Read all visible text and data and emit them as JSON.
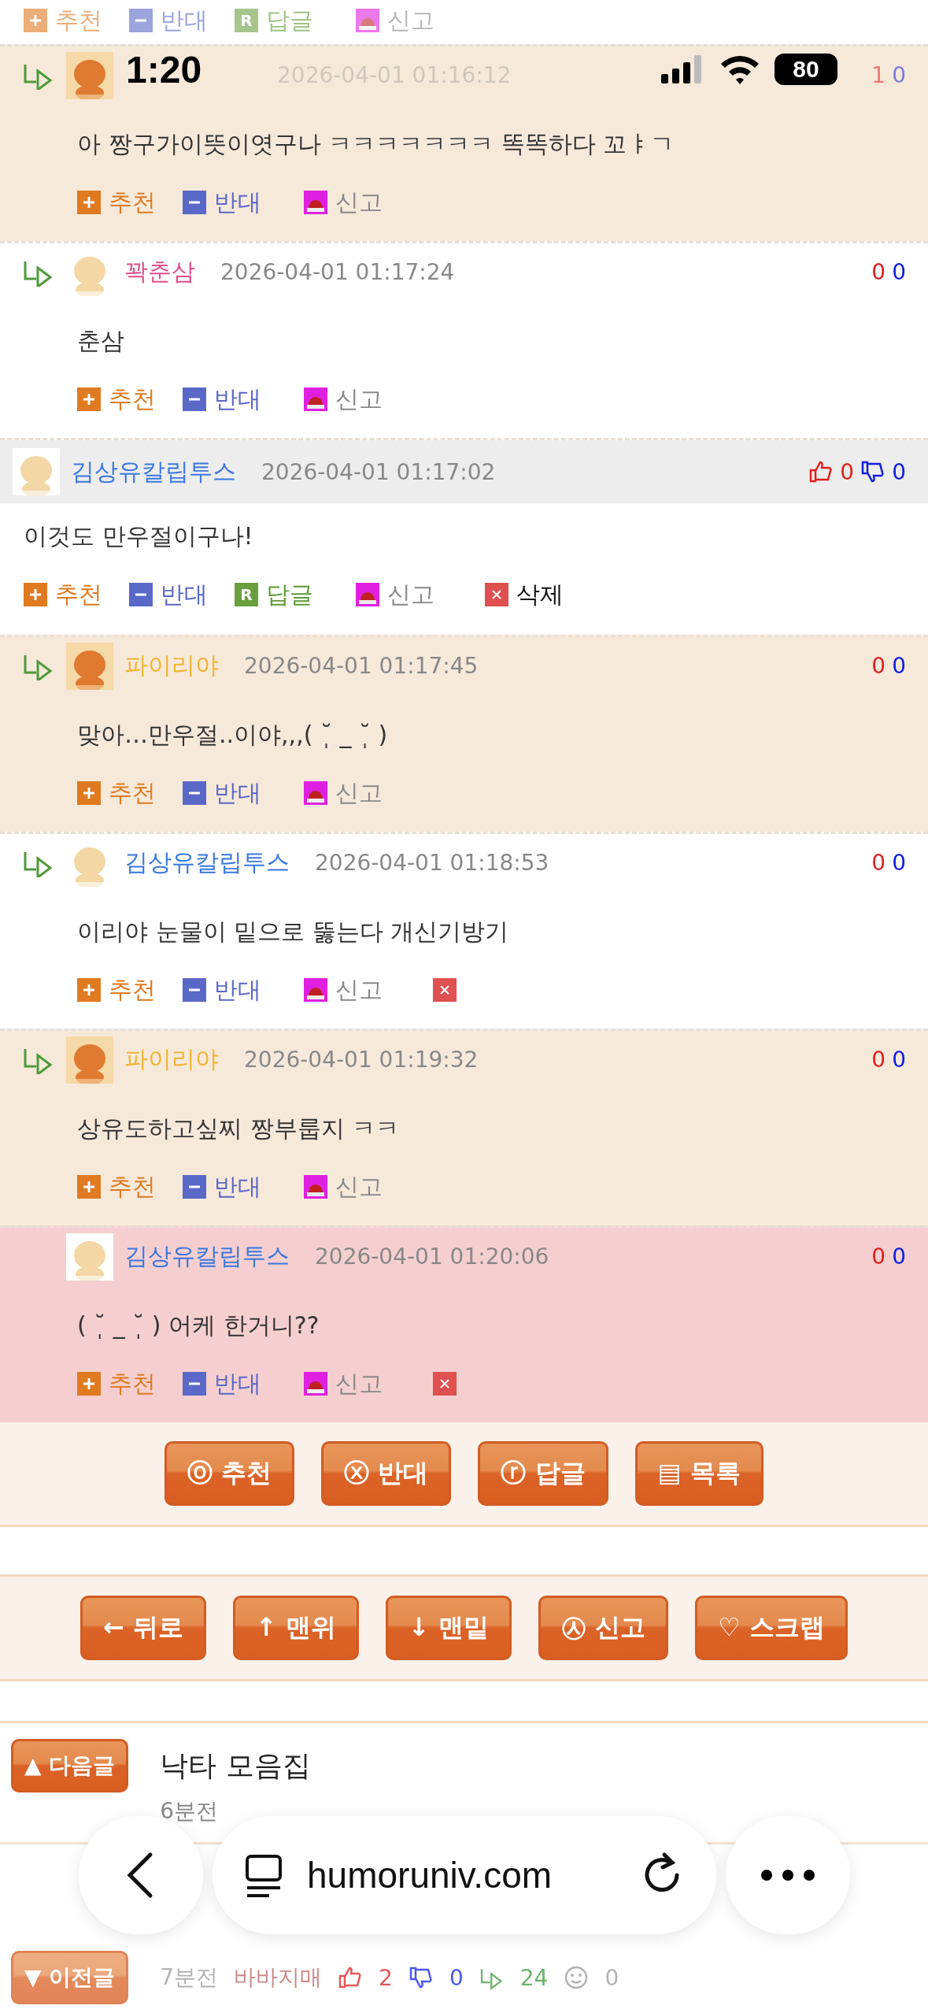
{
  "status_bar": {
    "time": "1:20",
    "battery": "80"
  },
  "top_actions": [
    {
      "kind": "up",
      "label": "추천"
    },
    {
      "kind": "down",
      "label": "반대"
    },
    {
      "kind": "reply",
      "label": "답글",
      "badge": "R"
    },
    {
      "kind": "report",
      "label": "신고"
    }
  ],
  "comments": [
    {
      "kind": "author_reply",
      "reply_mark": true,
      "dimmed": true,
      "date": "2026-04-01 01:16:12",
      "up": "1",
      "down": "0",
      "text": "아 짱구가이뜻이엿구나 ㅋㅋㅋㅋㅋㅋㅋ 똑똑하다 꼬ㅑㄱ",
      "actions": [
        {
          "kind": "up",
          "label": "추천"
        },
        {
          "kind": "down",
          "label": "반대"
        },
        {
          "kind": "report",
          "label": "신고"
        }
      ]
    },
    {
      "kind": "reply",
      "reply_mark": true,
      "dimmed": false,
      "name": "꽉춘삼",
      "color": "#e0508a",
      "date": "2026-04-01 01:17:24",
      "up": "0",
      "down": "0",
      "text": "춘삼",
      "actions": [
        {
          "kind": "up",
          "label": "추천"
        },
        {
          "kind": "down",
          "label": "반대"
        },
        {
          "kind": "report",
          "label": "신고"
        }
      ]
    },
    {
      "kind": "parent",
      "reply_mark": false,
      "dimmed": false,
      "name": "김상유칼립투스",
      "color": "#3a78e0",
      "date": "2026-04-01 01:17:02",
      "up": "0",
      "down": "0",
      "text": "이것도 만우절이구나!",
      "actions": [
        {
          "kind": "up",
          "label": "추천"
        },
        {
          "kind": "down",
          "label": "반대"
        },
        {
          "kind": "reply",
          "label": "답글",
          "badge": "R"
        },
        {
          "kind": "report",
          "label": "신고"
        },
        {
          "kind": "delete",
          "label": "삭제"
        }
      ]
    },
    {
      "kind": "author_reply",
      "reply_mark": true,
      "dimmed": false,
      "name": "파이리야",
      "color": "#f0b430",
      "date": "2026-04-01 01:17:45",
      "up": "0",
      "down": "0",
      "text": "맞아…만우절..이야,,,( ˘̩ _ ˘̩ )",
      "actions": [
        {
          "kind": "up",
          "label": "추천"
        },
        {
          "kind": "down",
          "label": "반대"
        },
        {
          "kind": "report",
          "label": "신고"
        }
      ]
    },
    {
      "kind": "reply",
      "reply_mark": true,
      "dimmed": false,
      "name": "김상유칼립투스",
      "color": "#3a78e0",
      "date": "2026-04-01 01:18:53",
      "up": "0",
      "down": "0",
      "text": "이리야 눈물이 밑으로 뚫는다 개신기방기",
      "actions": [
        {
          "kind": "up",
          "label": "추천"
        },
        {
          "kind": "down",
          "label": "반대"
        },
        {
          "kind": "report",
          "label": "신고"
        },
        {
          "kind": "delete"
        }
      ]
    },
    {
      "kind": "author_reply",
      "reply_mark": true,
      "dimmed": false,
      "name": "파이리야",
      "color": "#f0b430",
      "date": "2026-04-01 01:19:32",
      "up": "0",
      "down": "0",
      "text": "상유도하고싶찌 짱부룹지 ㅋㅋ",
      "actions": [
        {
          "kind": "up",
          "label": "추천"
        },
        {
          "kind": "down",
          "label": "반대"
        },
        {
          "kind": "report",
          "label": "신고"
        }
      ]
    },
    {
      "kind": "new_reply",
      "reply_mark": false,
      "dimmed": false,
      "name": "김상유칼립투스",
      "color": "#3a78e0",
      "date": "2026-04-01 01:20:06",
      "up": "0",
      "down": "0",
      "text": "( ˘̩ _ ˘̩ ) 어케 한거니??",
      "actions": [
        {
          "kind": "up",
          "label": "추천"
        },
        {
          "kind": "down",
          "label": "반대"
        },
        {
          "kind": "report",
          "label": "신고"
        },
        {
          "kind": "delete"
        }
      ]
    }
  ],
  "post_buttons": [
    "ⓞ 추천",
    "ⓧ 반대",
    "ⓡ 답글",
    "▤ 목록"
  ],
  "nav_buttons": [
    "← 뒤로",
    "↑ 맨위",
    "↓ 맨밑",
    "㉦ 신고",
    "♡ 스크랩"
  ],
  "next_post": {
    "button": "▲ 다음글",
    "title": "낙타 모음집",
    "time": "6분전"
  },
  "prev_post": {
    "button": "▼ 이전글",
    "time": "7분전",
    "author": "바바지매",
    "likes": "2",
    "dislikes": "0",
    "replies": "24",
    "views": "0"
  },
  "browser": {
    "url": "humoruniv.com"
  }
}
